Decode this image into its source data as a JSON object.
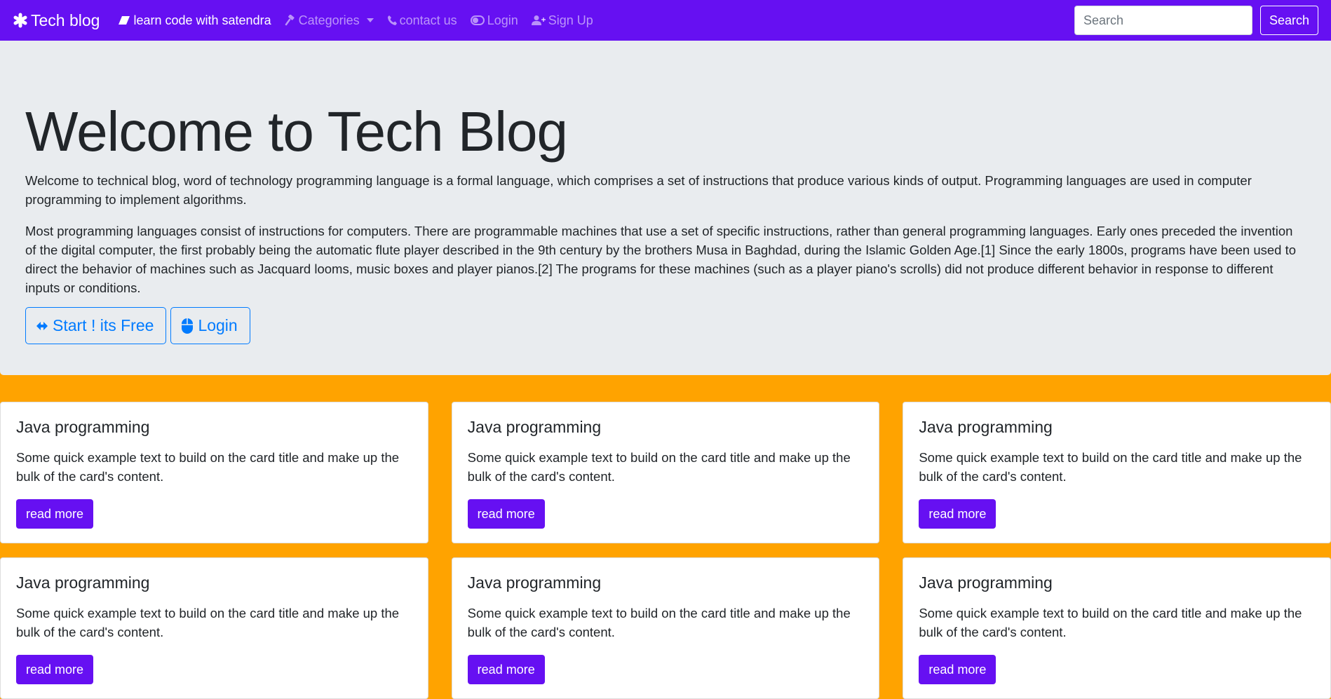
{
  "navbar": {
    "brand": "Tech blog",
    "brand_icon": "asterisk-icon",
    "items": [
      {
        "label": "learn code with satendra",
        "icon": "eraser-icon",
        "active": true
      },
      {
        "label": "Categories",
        "icon": "gavel-icon",
        "dropdown": true
      },
      {
        "label": "contact us",
        "icon": "phone-icon"
      },
      {
        "label": "Login",
        "icon": "toggle-icon"
      },
      {
        "label": "Sign Up",
        "icon": "user-plus-icon"
      }
    ],
    "search_placeholder": "Search",
    "search_button": "Search"
  },
  "hero": {
    "title": "Welcome to Tech Blog",
    "paragraph1": "Welcome to technical blog, word of technology programming language is a formal language, which comprises a set of instructions that produce various kinds of output. Programming languages are used in computer programming to implement algorithms.",
    "paragraph2": "Most programming languages consist of instructions for computers. There are programmable machines that use a set of specific instructions, rather than general programming languages. Early ones preceded the invention of the digital computer, the first probably being the automatic flute player described in the 9th century by the brothers Musa in Baghdad, during the Islamic Golden Age.[1] Since the early 1800s, programs have been used to direct the behavior of machines such as Jacquard looms, music boxes and player pianos.[2] The programs for these machines (such as a player piano's scrolls) did not produce different behavior in response to different inputs or conditions.",
    "start_button": "Start ! its Free",
    "login_button": "Login"
  },
  "cards": [
    {
      "title": "Java programming",
      "text": "Some quick example text to build on the card title and make up the bulk of the card's content.",
      "button": "read more"
    },
    {
      "title": "Java programming",
      "text": "Some quick example text to build on the card title and make up the bulk of the card's content.",
      "button": "read more"
    },
    {
      "title": "Java programming",
      "text": "Some quick example text to build on the card title and make up the bulk of the card's content.",
      "button": "read more"
    },
    {
      "title": "Java programming",
      "text": "Some quick example text to build on the card title and make up the bulk of the card's content.",
      "button": "read more"
    },
    {
      "title": "Java programming",
      "text": "Some quick example text to build on the card title and make up the bulk of the card's content.",
      "button": "read more"
    },
    {
      "title": "Java programming",
      "text": "Some quick example text to build on the card title and make up the bulk of the card's content.",
      "button": "read more"
    }
  ],
  "colors": {
    "navbar": "#6610f2",
    "page_background": "#ffa300",
    "jumbotron": "#e9ecef",
    "outline_primary": "#007bff"
  }
}
